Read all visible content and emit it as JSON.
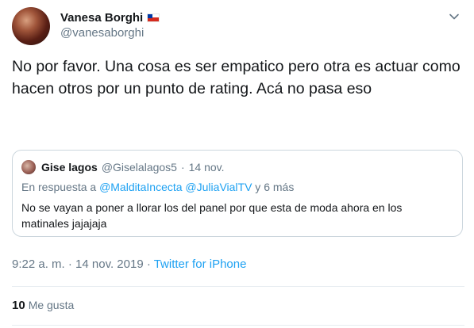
{
  "author": {
    "display_name": "Vanesa Borghi",
    "handle": "@vanesaborghi",
    "flag_icon": "chile-flag-icon"
  },
  "tweet": {
    "text": "No por favor. Una cosa es ser empatico pero otra es actuar como hacen otros por un punto de rating. Acá no pasa eso"
  },
  "quote": {
    "display_name": "Gise lagos",
    "handle": "@Giselalagos5",
    "separator": "·",
    "date": "14 nov.",
    "reply_prefix": "En respuesta a ",
    "reply_mentions": "@MalditaIncecta @JuliaVialTV",
    "reply_suffix": " y 6 más",
    "text": "No se vayan a poner a llorar los del panel por que esta de moda ahora en los matinales jajajaja"
  },
  "meta": {
    "time_date": "9:22 a. m. · 14 nov. 2019 · ",
    "source": "Twitter for iPhone"
  },
  "stats": {
    "likes_count": "10",
    "likes_label": "Me gusta"
  },
  "colors": {
    "accent": "#1da1f2",
    "secondary_text": "#657786",
    "primary_text": "#14171a",
    "border": "#ccd6dd"
  }
}
